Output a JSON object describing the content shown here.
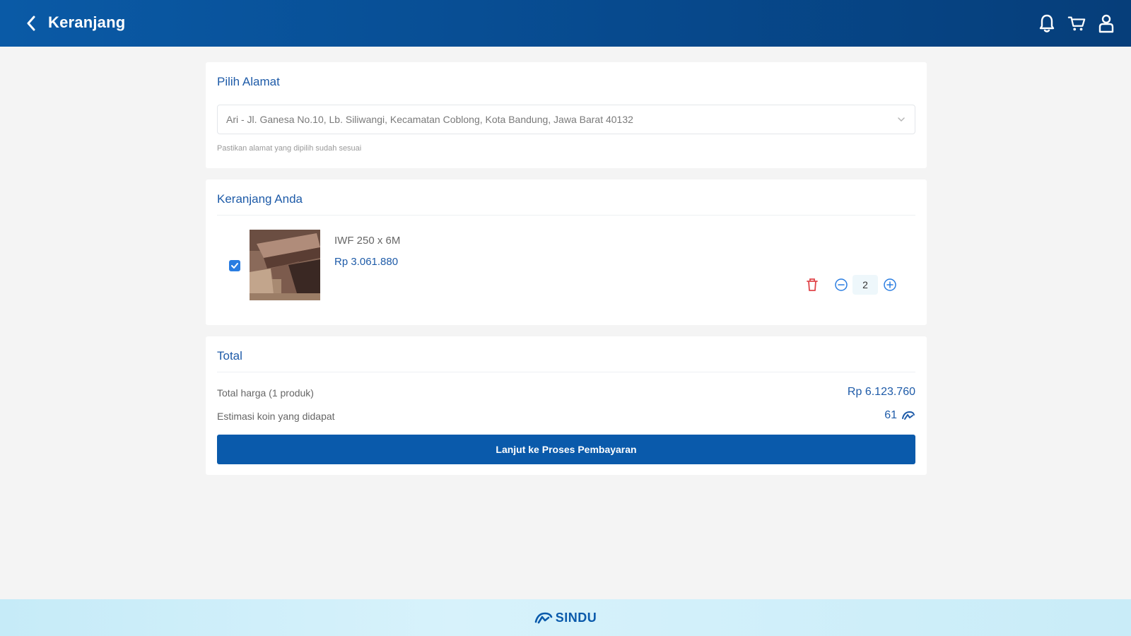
{
  "header": {
    "title": "Keranjang",
    "icons": [
      "chevron-left-icon",
      "bell-icon",
      "cart-icon",
      "user-icon"
    ],
    "background": "#0a5aa6"
  },
  "address_section": {
    "title": "Pilih Alamat",
    "selected_address": "Ari - Jl. Ganesa No.10, Lb. Siliwangi, Kecamatan Coblong, Kota Bandung, Jawa Barat 40132",
    "hint": "Pastikan alamat yang dipilih sudah sesuai"
  },
  "cart_section": {
    "title": "Keranjang Anda",
    "items": [
      {
        "name": "IWF 250 x 6M",
        "price": "Rp 3.061.880",
        "quantity": "2",
        "checked": true
      }
    ]
  },
  "total_section": {
    "title": "Total",
    "total_label": "Total harga (1 produk)",
    "total_value": "Rp 6.123.760",
    "coin_label": "Estimasi koin yang didapat",
    "coin_value": "61",
    "checkout_button": "Lanjut ke Proses Pembayaran"
  },
  "footer": {
    "brand": "SINDU"
  },
  "colors": {
    "primary": "#0a5aab",
    "accent_text": "#1e5ba8",
    "delete": "#e0454a",
    "background": "#f4f4f4"
  }
}
